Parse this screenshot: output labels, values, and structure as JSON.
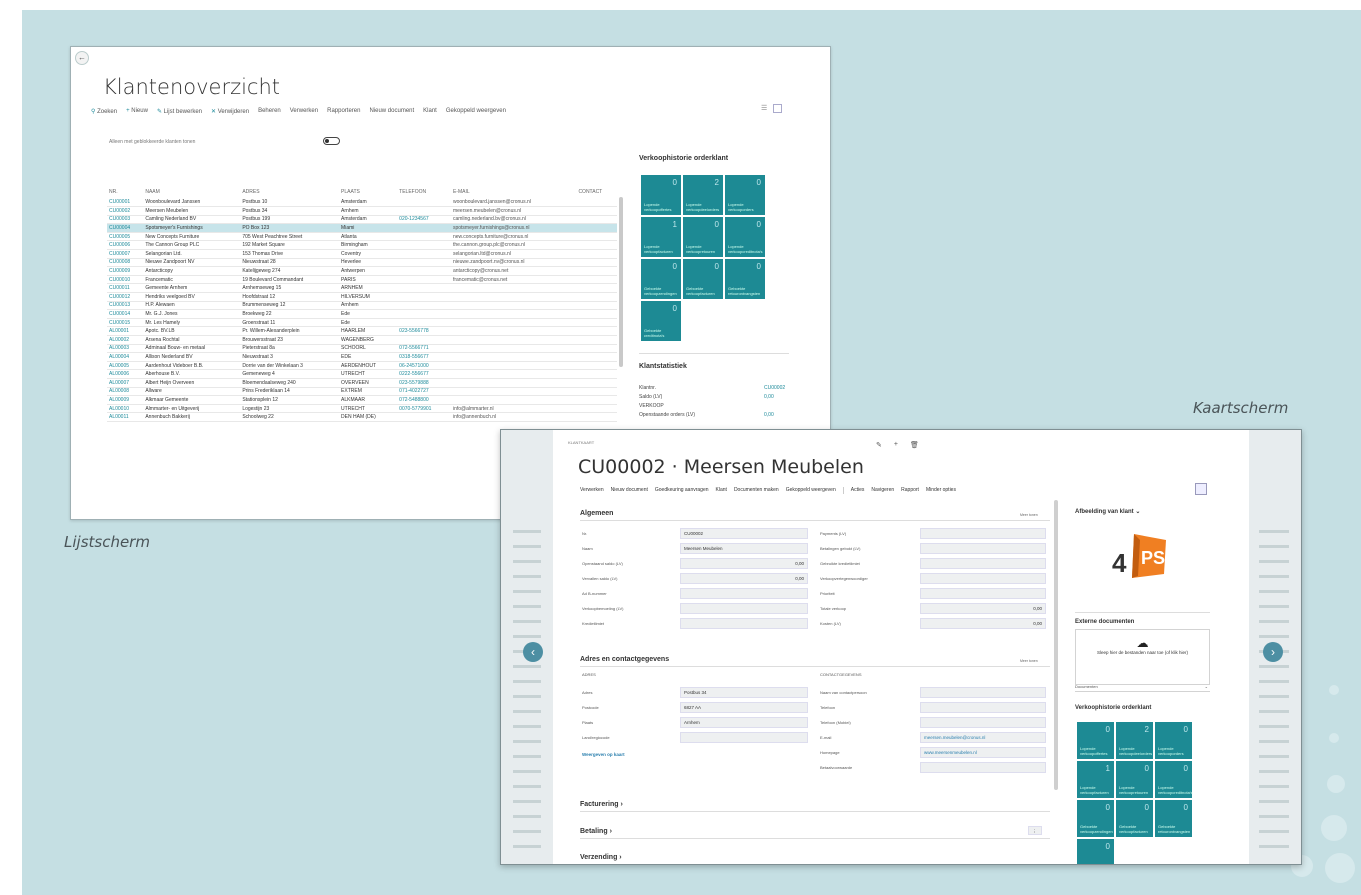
{
  "captions": {
    "list": "Lijstscherm",
    "card": "Kaartscherm"
  },
  "list_window": {
    "title": "Klantenoverzicht",
    "toolbar": [
      "Zoeken",
      "Nieuw",
      "Lijst bewerken",
      "Verwijderen",
      "Beheren",
      "Verwerken",
      "Rapporteren",
      "Nieuw document",
      "Klant",
      "Gekoppeld weergeven"
    ],
    "toggle_label": "Alleen met geblokkeerde klanten tonen",
    "columns": [
      "NR.",
      "NAAM",
      "ADRES",
      "PLAATS",
      "TELEFOON",
      "E-MAIL",
      "CONTACT"
    ],
    "rows": [
      [
        "CU00001",
        "Woonboulevard Janssen",
        "Postbus 10",
        "Amsterdam",
        "",
        "woonboulevard.janssen@cronus.nl",
        ""
      ],
      [
        "CU00002",
        "Meersen Meubelen",
        "Postbus 34",
        "Arnhem",
        "",
        "meersen.meubelen@cronus.nl",
        ""
      ],
      [
        "CU00003",
        "Camling Nederland BV",
        "Postbus 199",
        "Amsterdam",
        "020-1234567",
        "camling.nederland.bv@cronus.nl",
        ""
      ],
      [
        "CU00004",
        "Spotsmeyer's Furnishings",
        "PO Box 123",
        "Miami",
        "",
        "spotsmeyer.furnishings@cronus.nl",
        ""
      ],
      [
        "CU00005",
        "New Concepts Furniture",
        "705 West Peachtree Street",
        "Atlanta",
        "",
        "new.concepts.furniture@cronus.nl",
        ""
      ],
      [
        "CU00006",
        "The Cannon Group PLC",
        "192 Market Square",
        "Birmingham",
        "",
        "the.cannon.group.plc@cronus.nl",
        ""
      ],
      [
        "CU00007",
        "Selangorian Ltd.",
        "153 Thomas Drive",
        "Coventry",
        "",
        "selangorian.ltd@cronus.nl",
        ""
      ],
      [
        "CU00008",
        "Nieuwe Zandpoort NV",
        "Nieuwstraat 28",
        "Heverlee",
        "",
        "nieuwe.zandpoort.nv@cronus.nl",
        ""
      ],
      [
        "CU00009",
        "Antarcticopy",
        "Katelijgeweg 274",
        "Antwerpen",
        "",
        "antarcticopy@cronus.net",
        ""
      ],
      [
        "CU00010",
        "Francematic",
        "19 Boulevard Commandant",
        "PARIS",
        "",
        "francematic@cronus.net",
        ""
      ],
      [
        "CU00011",
        "Gemeente Arnhem",
        "Arnhemseweg 15",
        "ARNHEM",
        "",
        "",
        ""
      ],
      [
        "CU00012",
        "Hendriks veelgoed BV",
        "Hoofdstraat 12",
        "HILVERSUM",
        "",
        "",
        ""
      ],
      [
        "CU00013",
        "H.P. Alewaen",
        "Brummenseweg 12",
        "Arnhem",
        "",
        "",
        ""
      ],
      [
        "CU00014",
        "Mr. G.J. Jones",
        "Broekweg 22",
        "Ede",
        "",
        "",
        ""
      ],
      [
        "CU00015",
        "Mr. Les Hamely",
        "Groenstraat 11",
        "Ede",
        "",
        "",
        ""
      ],
      [
        "AL00001",
        "Apotc. BV.LB",
        "Pr. Willem-Alexanderplein",
        "HAARLEM",
        "023-5566778",
        "",
        ""
      ],
      [
        "AL00002",
        "Arsena Rochtal",
        "Brouwersstraat 23",
        "WAGENBERG",
        "",
        "",
        ""
      ],
      [
        "AL00003",
        "Adminaal Bouw- en metaal",
        "Pieterstraat 8a",
        "SCHOORL",
        "072-5566771",
        "",
        ""
      ],
      [
        "AL00004",
        "Allison Nederland BV",
        "Nieuwstraat 3",
        "EDE",
        "0318-556677",
        "",
        ""
      ],
      [
        "AL00005",
        "Aardenhout Videboer B.B.",
        "Dorrie van der Winkelaan 3",
        "AERDENHOUT",
        "06-24571000",
        "",
        ""
      ],
      [
        "AL00006",
        "Aberhouse B.V.",
        "Gemeneweg 4",
        "UTRECHT",
        "0222-556677",
        "",
        ""
      ],
      [
        "AL00007",
        "Albert Heijn Overveen",
        "Bloemendaalseweg 240",
        "OVERVEEN",
        "023-5579888",
        "",
        ""
      ],
      [
        "AL00008",
        "Allware",
        "Prins Frederiklaan 14",
        "EXTREM",
        "071-4022727",
        "",
        ""
      ],
      [
        "AL00009",
        "Alkmaar Gemeente",
        "Stationsplein 12",
        "ALKMAAR",
        "072-5488800",
        "",
        ""
      ],
      [
        "AL00010",
        "Almmarter- en Uitgeverij",
        "Logestijn 23",
        "UTRECHT",
        "0070-5779901",
        "info@almmarter.nl",
        ""
      ],
      [
        "AL00011",
        "Annenbuch Bakkerij",
        "Schoolweg 22",
        "DEN HAM (DE)",
        "",
        "info@annenbuch.nl",
        ""
      ]
    ],
    "factbox_title": "Verkoophistorie orderklant",
    "tiles": [
      {
        "num": "0",
        "label": "Lopende verkoopoffertes"
      },
      {
        "num": "2",
        "label": "Lopende verkoopdeelorders"
      },
      {
        "num": "0",
        "label": "Lopende verkooporders"
      },
      {
        "num": "1",
        "label": "Lopende verkoopfacturen"
      },
      {
        "num": "0",
        "label": "Lopende verkoopretouren"
      },
      {
        "num": "0",
        "label": "Lopende verkoopcreditnota's"
      },
      {
        "num": "0",
        "label": "Geboekte verkoopzendingen"
      },
      {
        "num": "0",
        "label": "Geboekte verkoopfacturen"
      },
      {
        "num": "0",
        "label": "Geboekte retourontvangsten"
      },
      {
        "num": "0",
        "label": "Geboekte creditnota's"
      }
    ],
    "stats_title": "Klantstatistiek",
    "stats": [
      {
        "label": "Klantnr.",
        "value": "CU00002"
      },
      {
        "label": "Saldo (LV)",
        "value": "0,00"
      },
      {
        "label": "VERKOOP",
        "value": ""
      },
      {
        "label": "Openstaande orders (LV)",
        "value": "0,00"
      }
    ]
  },
  "card_window": {
    "crumb": "KLANTKAART",
    "title": "CU00002 · Meersen Meubelen",
    "toolbar": [
      "Verwerken",
      "Nieuw document",
      "Goedkeuring aanvragen",
      "Klant",
      "Documenten maken",
      "Gekoppeld weergeven",
      "Acties",
      "Navigeren",
      "Rapport",
      "Minder opties"
    ],
    "general": {
      "title": "Algemeen",
      "show_more": "Meer tonen",
      "left": [
        {
          "label": "Nr.",
          "value": "CU00002"
        },
        {
          "label": "Naam",
          "value": "Meersen Meubelen"
        },
        {
          "label": "Openstaand saldo (LV)",
          "value": "0,00"
        },
        {
          "label": "Vervallen saldo (LV)",
          "value": "0,00"
        },
        {
          "label": "Ad B-nummer",
          "value": ""
        },
        {
          "label": "Verkoopbemoeiing (LV)",
          "value": ""
        },
        {
          "label": "Kredietlimiet",
          "value": ""
        }
      ],
      "right": [
        {
          "label": "Payments (LV)",
          "value": ""
        },
        {
          "label": "Betalingen gebokt (LV)",
          "value": ""
        },
        {
          "label": "Gebruikte kredietlimiet",
          "value": ""
        },
        {
          "label": "Verkoopvertegenwoordiger",
          "value": ""
        },
        {
          "label": "Prioriteit",
          "value": ""
        },
        {
          "label": "Totale verkoop",
          "value": "0,00"
        },
        {
          "label": "Kosten (LV)",
          "value": "0,00"
        }
      ]
    },
    "address": {
      "title": "Adres en contactgegevens",
      "show_more": "Meer tonen",
      "left_header": "ADRES",
      "right_header": "CONTACTGEGEVENS",
      "left": [
        {
          "label": "Adres",
          "value": "Postbus 34"
        },
        {
          "label": "Postcode",
          "value": "6827 AA"
        },
        {
          "label": "Plaats",
          "value": "Arnhem"
        },
        {
          "label": "Land/regiocode",
          "value": ""
        }
      ],
      "map_link": "Weergeven op kaart",
      "right": [
        {
          "label": "Naam van contactpersoon",
          "value": ""
        },
        {
          "label": "Telefoon",
          "value": ""
        },
        {
          "label": "Telefoon (Mobiel)",
          "value": ""
        },
        {
          "label": "E-mail",
          "value": "meersen.meubelen@cronus.nl"
        },
        {
          "label": "Homepage",
          "value": "www.meersenmeubelen.nl"
        },
        {
          "label": "Betaalvoorwaarde",
          "value": ""
        }
      ]
    },
    "collapsed": [
      "Facturering",
      "Betaling",
      "Verzending"
    ],
    "factbox": {
      "image_title": "Afbeelding van klant",
      "logo_text": "PS",
      "logo_num": "4",
      "docs_title": "Externe documenten",
      "drop_text": "Sleep hier de bestanden naar toe (of klik hier)",
      "docs_select": "Documenten",
      "history_title": "Verkoophistorie orderklant"
    }
  }
}
